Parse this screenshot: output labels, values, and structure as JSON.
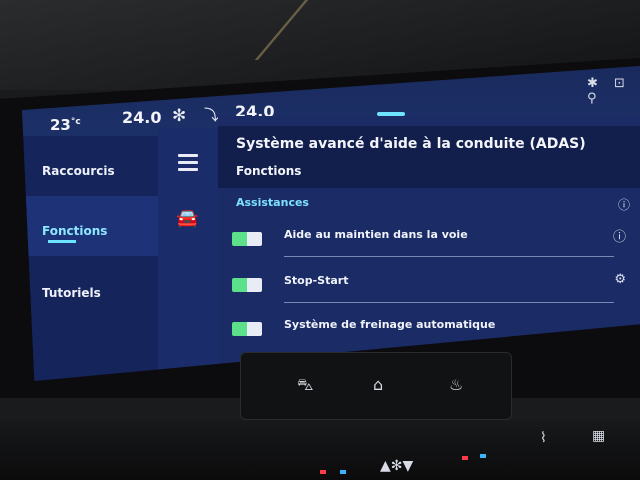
{
  "status_bar": {
    "temp_left": "23",
    "temp_unit": "°c",
    "setpoint_left": "24.0",
    "setpoint_right": "24.0",
    "fan_icon": "fan-icon",
    "seat_icon": "seat-airflow-icon",
    "right_icons": "✱ ⊡ ⚲"
  },
  "sidebar": {
    "items": [
      {
        "label": "Raccourcis"
      },
      {
        "label": "Fonctions",
        "active": true
      },
      {
        "label": "Tutoriels"
      }
    ]
  },
  "main": {
    "title": "Système avancé d'aide à la conduite (ADAS)",
    "section": "Fonctions",
    "group": "Assistances",
    "rows": [
      {
        "label": "Aide au maintien dans la voie",
        "enabled": true,
        "icon": "info-icon"
      },
      {
        "label": "Stop-Start",
        "enabled": true,
        "icon": "gear-icon"
      },
      {
        "label": "Système de freinage automatique",
        "enabled": true,
        "icon": ""
      }
    ]
  },
  "colors": {
    "accent": "#6ee3ff",
    "toggle_on": "#5ce08a",
    "panel": "#1a2b66"
  }
}
